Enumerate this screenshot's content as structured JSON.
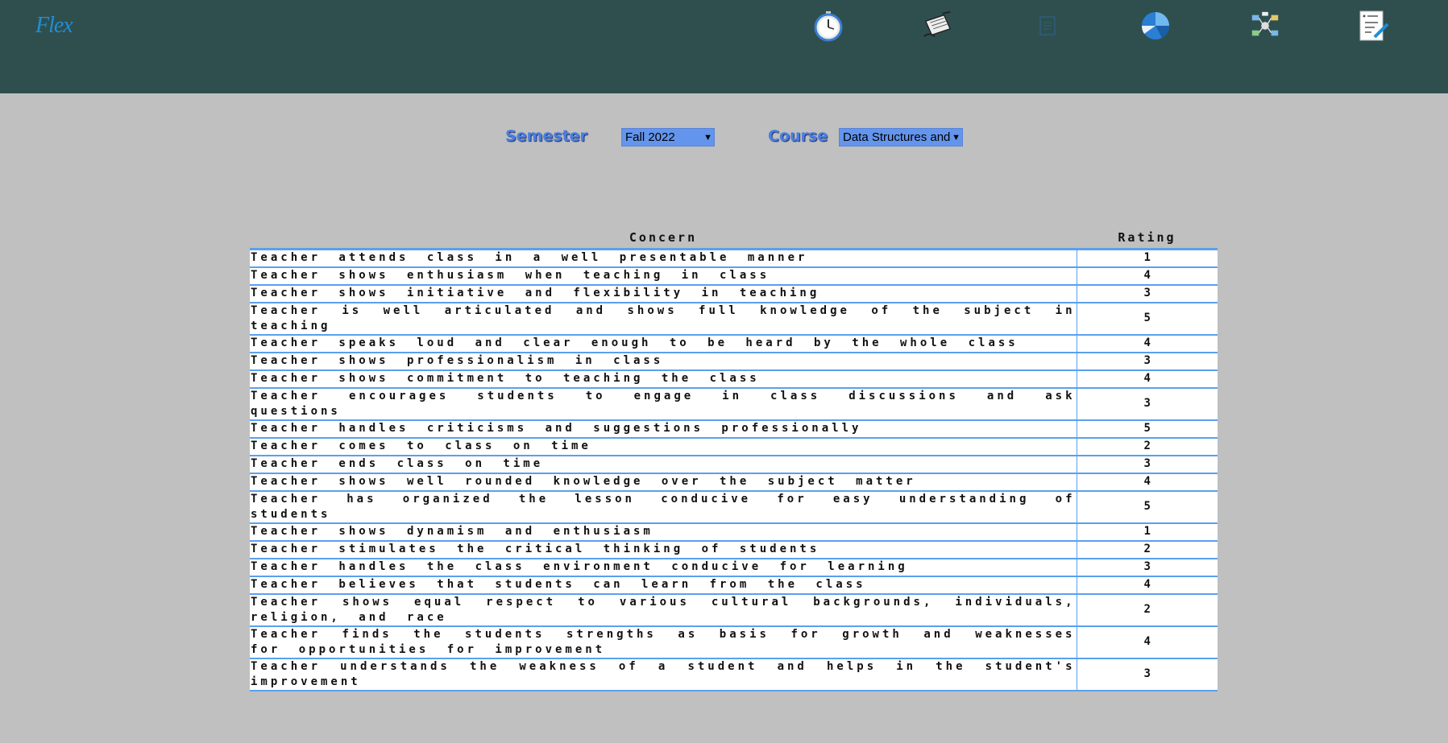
{
  "app": {
    "logo_text": "Flex"
  },
  "nav": {
    "icons": [
      {
        "name": "stopwatch-icon"
      },
      {
        "name": "pen-document-icon"
      },
      {
        "name": "document-outline-icon"
      },
      {
        "name": "pie-chart-icon"
      },
      {
        "name": "network-icon"
      },
      {
        "name": "edit-notes-icon"
      }
    ]
  },
  "filters": {
    "semester_label": "Semester",
    "semester_value": "Fall 2022",
    "course_label": "Course",
    "course_value": "Data Structures and"
  },
  "table": {
    "headers": [
      "Concern",
      "Rating"
    ],
    "rows": [
      {
        "concern": "Teacher attends class in a well presentable manner",
        "rating": "1"
      },
      {
        "concern": "Teacher shows enthusiasm when teaching in class",
        "rating": "4"
      },
      {
        "concern": "Teacher shows initiative and flexibility in teaching",
        "rating": "3"
      },
      {
        "concern": "Teacher is well articulated and shows full knowledge of the subject in teaching",
        "rating": "5"
      },
      {
        "concern": "Teacher speaks loud and clear enough to be heard by the whole class",
        "rating": "4"
      },
      {
        "concern": "Teacher shows professionalism in class",
        "rating": "3"
      },
      {
        "concern": "Teacher shows commitment to teaching the class",
        "rating": "4"
      },
      {
        "concern": "Teacher encourages students to engage in class discussions and ask questions",
        "rating": "3"
      },
      {
        "concern": "Teacher handles criticisms and suggestions professionally",
        "rating": "5"
      },
      {
        "concern": "Teacher comes to class on time",
        "rating": "2"
      },
      {
        "concern": "Teacher ends class on time",
        "rating": "3"
      },
      {
        "concern": "Teacher shows well rounded knowledge over the subject matter",
        "rating": "4"
      },
      {
        "concern": "Teacher has organized the lesson conducive for easy understanding of students",
        "rating": "5"
      },
      {
        "concern": "Teacher shows dynamism and enthusiasm",
        "rating": "1"
      },
      {
        "concern": "Teacher stimulates the critical thinking of students",
        "rating": "2"
      },
      {
        "concern": "Teacher handles the class environment conducive for learning",
        "rating": "3"
      },
      {
        "concern": "Teacher believes that students can learn from the class",
        "rating": "4"
      },
      {
        "concern": "Teacher shows equal respect to various cultural backgrounds, individuals, religion, and race",
        "rating": "2"
      },
      {
        "concern": "Teacher finds the students strengths as basis for growth and weaknesses for opportunities for improvement",
        "rating": "4"
      },
      {
        "concern": "Teacher understands the weakness of a student and helps in the student's improvement",
        "rating": "3"
      }
    ]
  },
  "colors": {
    "topbar": "#2f4f4f",
    "background": "#c0c0c0",
    "accent": "#6495ed",
    "row_border": "#5aa0ee"
  }
}
